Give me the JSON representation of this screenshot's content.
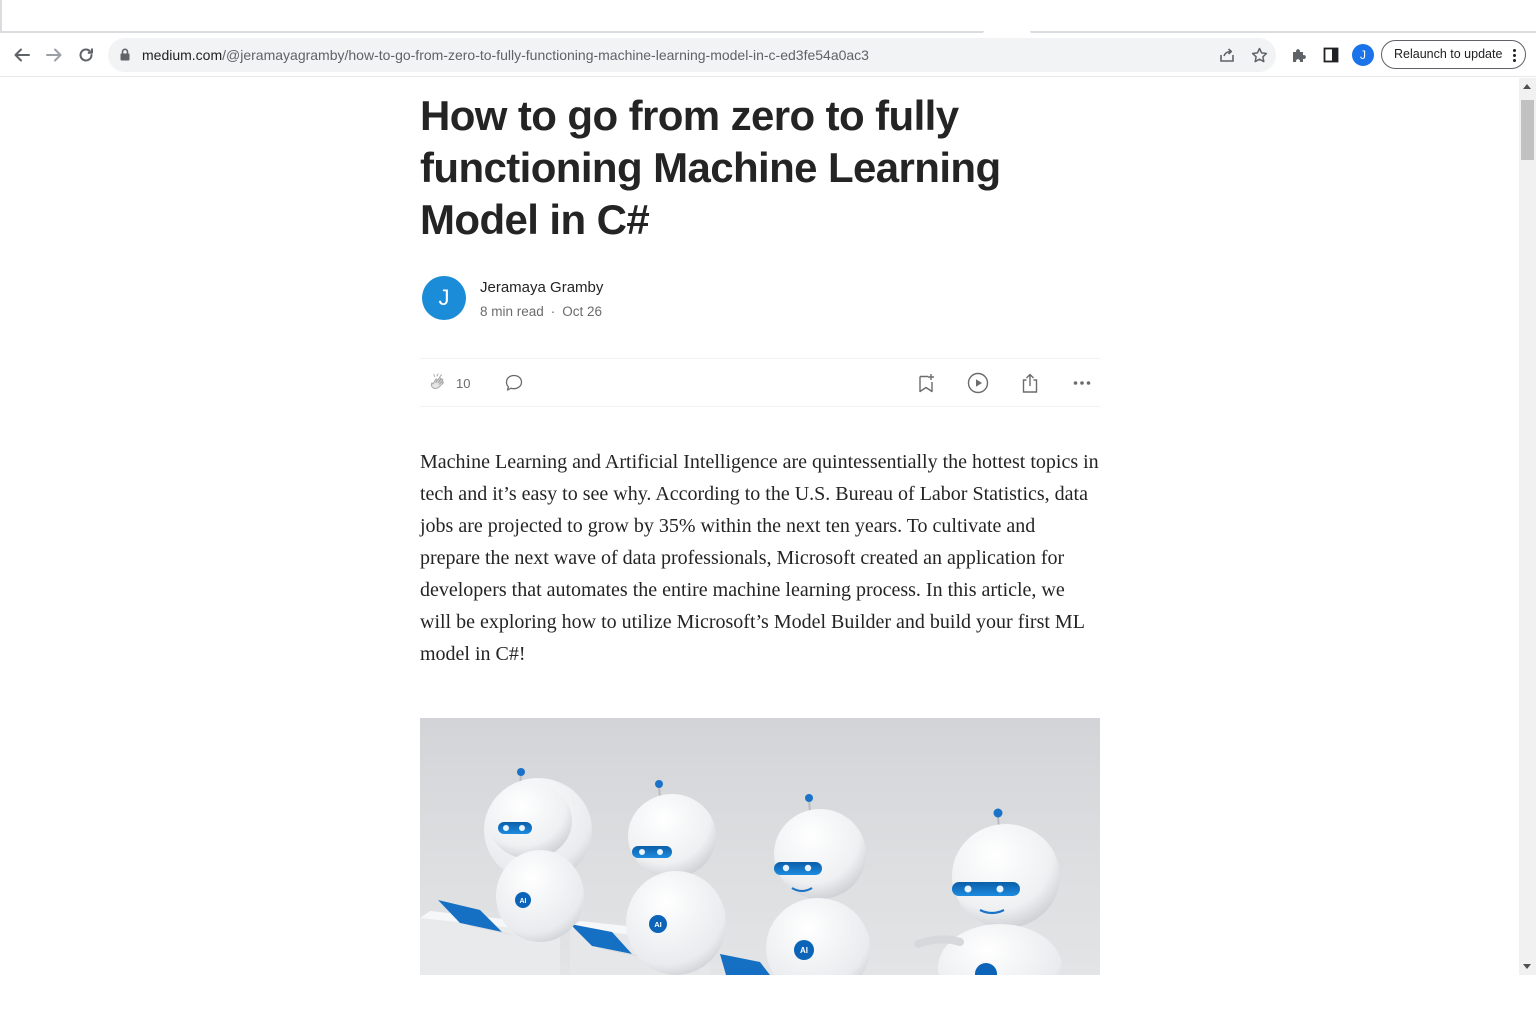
{
  "browser": {
    "url_host": "medium.com",
    "url_path": "/@jeramayagramby/how-to-go-from-zero-to-fully-functioning-machine-learning-model-in-c-ed3fe54a0ac3",
    "profile_initial": "J",
    "relaunch_label": "Relaunch to update"
  },
  "article": {
    "title": "How to go from zero to fully functioning Machine Learning Model in C#",
    "author": {
      "initial": "J",
      "name": "Jeramaya Gramby",
      "read_time": "8 min read",
      "separator": "·",
      "date": "Oct 26"
    },
    "claps": "10",
    "body": "Machine Learning and Artificial Intelligence are quintessentially the hottest topics in tech and it’s easy to see why. According to the U.S. Bureau of Labor Statistics, data jobs are projected to grow by 35% within the next ten years. To cultivate and prepare the next wave of data professionals, Microsoft created an application for developers that automates the entire machine learning process. In this article, we will be exploring how to utilize Microsoft’s Model Builder and build your first ML model in C#!",
    "hero_badge": "AI"
  },
  "colors": {
    "accent_blue": "#1a8cd8",
    "text": "#242424",
    "muted": "#6b6b6b"
  }
}
